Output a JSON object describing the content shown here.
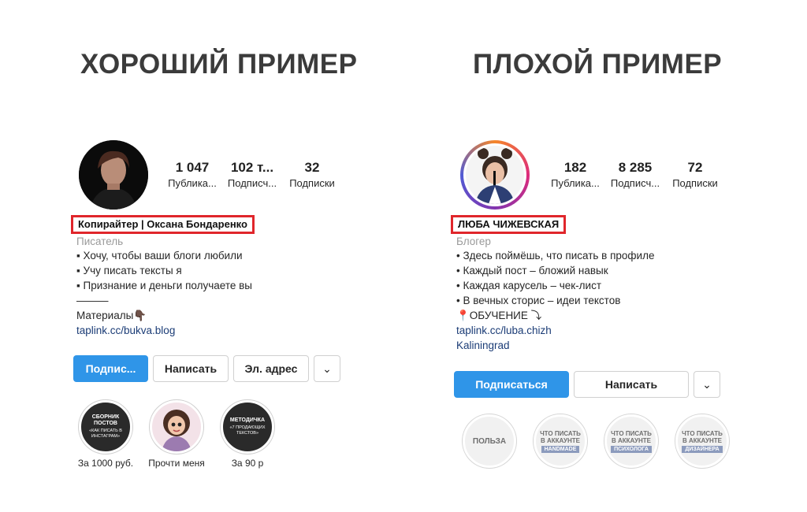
{
  "headings": {
    "good": "ХОРОШИЙ ПРИМЕР",
    "bad": "ПЛОХОЙ ПРИМЕР"
  },
  "good": {
    "stats": [
      {
        "value": "1 047",
        "label": "Публика..."
      },
      {
        "value": "102 т...",
        "label": "Подписч..."
      },
      {
        "value": "32",
        "label": "Подписки"
      }
    ],
    "name": "Копирайтер | Оксана Бондаренко",
    "category": "Писатель",
    "bio": [
      "▪ Хочу, чтобы ваши блоги любили",
      "▪ Учу писать тексты я",
      "▪ Признание и деньги получаете вы",
      "———",
      "Материалы👇🏿"
    ],
    "link": "taplink.cc/bukva.blog",
    "buttons": {
      "subscribe": "Подпис...",
      "message": "Написать",
      "email": "Эл. адрес",
      "chevron": "⌄"
    },
    "highlights": [
      {
        "title": "СБОРНИК ПОСТОВ",
        "sub": "«КАК ПИСАТЬ В ИНСТАГРАМ»",
        "label": "За 1000 руб."
      },
      {
        "title": "",
        "sub": "",
        "label": "Прочти меня"
      },
      {
        "title": "МЕТОДИЧКА",
        "sub": "«7 ПРОДАЮЩИХ ТЕКСТОВ»",
        "label": "За 90 р"
      }
    ]
  },
  "bad": {
    "stats": [
      {
        "value": "182",
        "label": "Публика..."
      },
      {
        "value": "8 285",
        "label": "Подписч..."
      },
      {
        "value": "72",
        "label": "Подписки"
      }
    ],
    "name": "ЛЮБА ЧИЖЕВСКАЯ",
    "category": "Блогер",
    "bio": [
      "• Здесь поймёшь, что писать в профиле",
      "• Каждый пост – бложий навык",
      "• Каждая карусель – чек-лист",
      "• В вечных сторис – идеи текстов",
      "📍ОБУЧЕНИЕ ⤵"
    ],
    "link": "taplink.cc/luba.chizh",
    "location": "Kaliningrad",
    "buttons": {
      "subscribe": "Подписаться",
      "message": "Написать",
      "chevron": "⌄"
    },
    "highlights": [
      {
        "big": "ПОЛЬЗА"
      },
      {
        "top": "ЧТО ПИСАТЬ",
        "mid": "В АККАУНТЕ",
        "tag": "HANDMADE"
      },
      {
        "top": "ЧТО ПИСАТЬ",
        "mid": "В АККАУНТЕ",
        "tag": "ПСИХОЛОГА"
      },
      {
        "top": "ЧТО ПИСАТЬ",
        "mid": "В АККАУНТЕ",
        "tag": "ДИЗАЙНЕРА"
      }
    ]
  },
  "colors": {
    "accent_blue": "#2f95e8",
    "highlight_red": "#e0262b",
    "link": "#1b3c76"
  }
}
